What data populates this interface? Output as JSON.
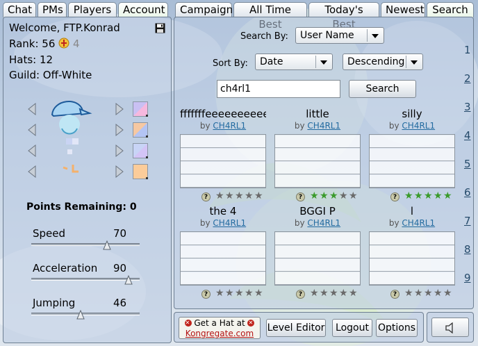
{
  "left_tabs": [
    {
      "label": "Chat",
      "active": false
    },
    {
      "label": "PMs",
      "active": false
    },
    {
      "label": "Players",
      "active": false
    },
    {
      "label": "Account",
      "active": true
    }
  ],
  "right_tabs": [
    {
      "label": "Campaign",
      "active": false
    },
    {
      "label": "All Time Best",
      "active": false
    },
    {
      "label": "Today's Best",
      "active": false
    },
    {
      "label": "Newest",
      "active": false
    },
    {
      "label": "Search",
      "active": true
    }
  ],
  "account": {
    "welcome": "Welcome, FTP.Konrad",
    "rank": "Rank: 56",
    "rank_extra": "4",
    "hats": "Hats: 12",
    "guild": "Guild: Off-White",
    "save_icon": "floppy-disk-icon"
  },
  "customize": {
    "swatches": [
      "#c9c0f3",
      "#f6c8a2",
      "#c8d4f6",
      "#fbcc9a"
    ],
    "points_label": "Points Remaining:",
    "points_value": "0"
  },
  "stats": [
    {
      "label": "Speed",
      "value": "70"
    },
    {
      "label": "Acceleration",
      "value": "90"
    },
    {
      "label": "Jumping",
      "value": "46"
    }
  ],
  "search": {
    "search_by_label": "Search By:",
    "search_by_value": "User Name",
    "sort_by_label": "Sort By:",
    "sort_by_value": "Date",
    "order_value": "Descending",
    "query": "ch4rl1",
    "search_button": "Search"
  },
  "levels": [
    {
      "title": "fffffffeeeeeeeeeee",
      "by": "by",
      "author": "CH4RL1",
      "stars": 0
    },
    {
      "title": "little",
      "by": "by",
      "author": "CH4RL1",
      "stars": 3
    },
    {
      "title": "silly",
      "by": "by",
      "author": "CH4RL1",
      "stars": 5
    },
    {
      "title": "the 4",
      "by": "by",
      "author": "CH4RL1",
      "stars": 0
    },
    {
      "title": "BGGI P",
      "by": "by",
      "author": "CH4RL1",
      "stars": 0
    },
    {
      "title": "l",
      "by": "by",
      "author": "CH4RL1",
      "stars": 0
    }
  ],
  "rating_help": "?",
  "pages": [
    "1",
    "2",
    "3",
    "4",
    "5",
    "6",
    "7",
    "8",
    "9"
  ],
  "current_page": "1",
  "colors": {
    "star_on": "#3a9a2a",
    "star_off": "#6a6a6a",
    "link": "#236ba0"
  },
  "bottom": {
    "hat_line1": "Get a Hat at",
    "hat_line2": "Kongregate.com",
    "level_editor": "Level Editor",
    "logout": "Logout",
    "options": "Options",
    "sound_icon": "speaker-icon"
  }
}
